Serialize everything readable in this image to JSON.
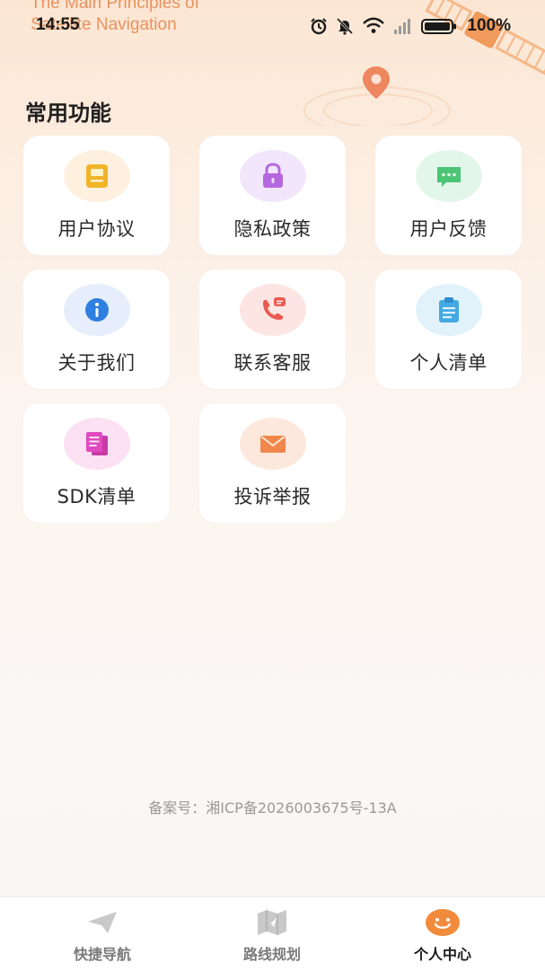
{
  "banner": {
    "line1": "The Main Principles of",
    "line2": "Satellite Navigation"
  },
  "status_bar": {
    "time": "14:55",
    "battery_percent": "100%",
    "icons": [
      "alarm-icon",
      "mute-bell-icon",
      "wifi-icon",
      "signal-icon",
      "battery-icon"
    ]
  },
  "section": {
    "title": "常用功能"
  },
  "features": [
    {
      "label": "用户协议",
      "icon": "document-icon",
      "bg": "#fdf0df",
      "color": "#f0b429"
    },
    {
      "label": "隐私政策",
      "icon": "lock-icon",
      "bg": "#f1e6fb",
      "color": "#b567de"
    },
    {
      "label": "用户反馈",
      "icon": "chat-icon",
      "bg": "#e3f6ea",
      "color": "#4cc476"
    },
    {
      "label": "关于我们",
      "icon": "info-icon",
      "bg": "#e6eefb",
      "color": "#2f7fe0"
    },
    {
      "label": "联系客服",
      "icon": "phone-icon",
      "bg": "#fce5e3",
      "color": "#ea5a4e"
    },
    {
      "label": "个人清单",
      "icon": "clipboard-icon",
      "bg": "#e2f2fb",
      "color": "#44a9e3"
    },
    {
      "label": "SDK清单",
      "icon": "pages-icon",
      "bg": "#fbe1f3",
      "color": "#e04bbf"
    },
    {
      "label": "投诉举报",
      "icon": "mail-icon",
      "bg": "#fce8dc",
      "color": "#f0874c"
    }
  ],
  "footer": {
    "icp": "备案号：湘ICP备2026003675号-13A"
  },
  "tabbar": {
    "tabs": [
      {
        "label": "快捷导航",
        "icon": "paper-plane-icon",
        "active": false
      },
      {
        "label": "路线规划",
        "icon": "map-icon",
        "active": false
      },
      {
        "label": "个人中心",
        "icon": "smiley-icon",
        "active": true
      }
    ]
  }
}
